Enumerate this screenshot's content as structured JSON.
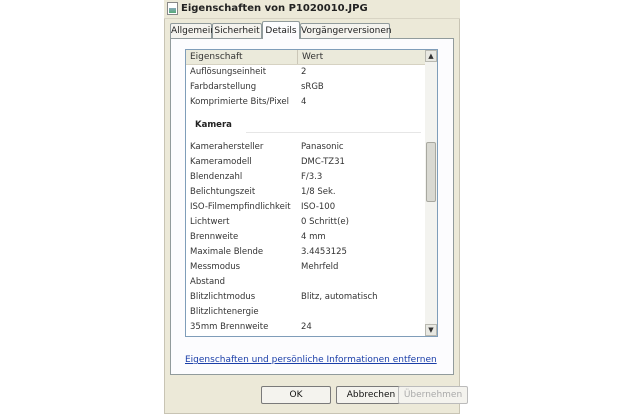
{
  "window": {
    "title": "Eigenschaften von P1020010.JPG"
  },
  "tabs": [
    {
      "label": "Allgemein",
      "active": false
    },
    {
      "label": "Sicherheit",
      "active": false
    },
    {
      "label": "Details",
      "active": true
    },
    {
      "label": "Vorgängerversionen",
      "active": false
    }
  ],
  "table": {
    "headers": {
      "property": "Eigenschaft",
      "value": "Wert"
    },
    "rows": [
      {
        "k": "Auflösungseinheit",
        "v": "2"
      },
      {
        "k": "Farbdarstellung",
        "v": "sRGB"
      },
      {
        "k": "Komprimierte Bits/Pixel",
        "v": "4"
      },
      {
        "section": "Kamera"
      },
      {
        "k": "Kamerahersteller",
        "v": "Panasonic"
      },
      {
        "k": "Kameramodell",
        "v": "DMC-TZ31"
      },
      {
        "k": "Blendenzahl",
        "v": "F/3.3"
      },
      {
        "k": "Belichtungszeit",
        "v": "1/8 Sek."
      },
      {
        "k": "ISO-Filmempfindlichkeit",
        "v": "ISO-100"
      },
      {
        "k": "Lichtwert",
        "v": "0 Schritt(e)"
      },
      {
        "k": "Brennweite",
        "v": "4 mm"
      },
      {
        "k": "Maximale Blende",
        "v": "3.4453125"
      },
      {
        "k": "Messmodus",
        "v": "Mehrfeld"
      },
      {
        "k": "Abstand",
        "v": ""
      },
      {
        "k": "Blitzlichtmodus",
        "v": "Blitz, automatisch"
      },
      {
        "k": "Blitzlichtenergie",
        "v": ""
      },
      {
        "k": "35mm Brennweite",
        "v": "24"
      }
    ]
  },
  "scrollbar": {
    "up": "▲",
    "down": "▼"
  },
  "links": {
    "remove": "Eigenschaften und persönliche Informationen entfernen"
  },
  "buttons": {
    "ok": "OK",
    "cancel": "Abbrechen",
    "apply": "Übernehmen"
  }
}
